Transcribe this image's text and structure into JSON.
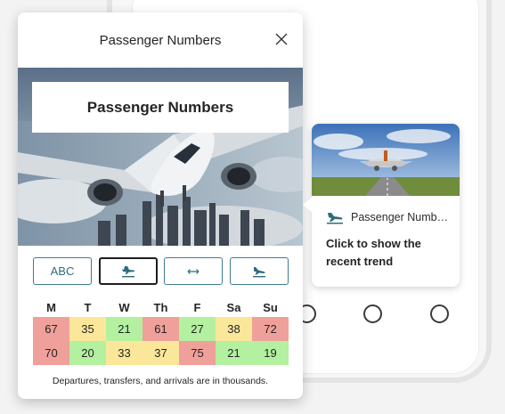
{
  "panel": {
    "header_title": "Passenger Numbers",
    "hero_title": "Passenger Numbers",
    "close_icon": "close-icon",
    "buttons": [
      {
        "label": "ABC",
        "icon": null,
        "selected": false
      },
      {
        "label": "",
        "icon": "plane-arrival-icon",
        "selected": true
      },
      {
        "label": "",
        "icon": "transfer-arrows-icon",
        "selected": false
      },
      {
        "label": "",
        "icon": "plane-departure-icon",
        "selected": false
      }
    ],
    "days": [
      "M",
      "T",
      "W",
      "Th",
      "F",
      "Sa",
      "Su"
    ],
    "rows": [
      [
        "67",
        "35",
        "21",
        "61",
        "27",
        "38",
        "72"
      ],
      [
        "70",
        "20",
        "33",
        "37",
        "75",
        "21",
        "19"
      ]
    ],
    "row_colors": [
      [
        "#f0a09a",
        "#fbe79a",
        "#b3f0a0",
        "#f0a09a",
        "#b3f0a0",
        "#fbe79a",
        "#f0a09a"
      ],
      [
        "#f0a09a",
        "#b3f0a0",
        "#fbe79a",
        "#fbe79a",
        "#f0a09a",
        "#b3f0a0",
        "#b3f0a0"
      ]
    ],
    "footnote": "Departures, transfers, and arrivals are in thousands."
  },
  "card": {
    "label": "Passenger Numbers",
    "icon": "plane-landing-icon",
    "description_line1": "Click to show the",
    "description_line2": "recent trend"
  },
  "colors": {
    "accent": "#2f6b7a",
    "high": "#f0a09a",
    "medium": "#fbe79a",
    "low": "#b3f0a0"
  }
}
